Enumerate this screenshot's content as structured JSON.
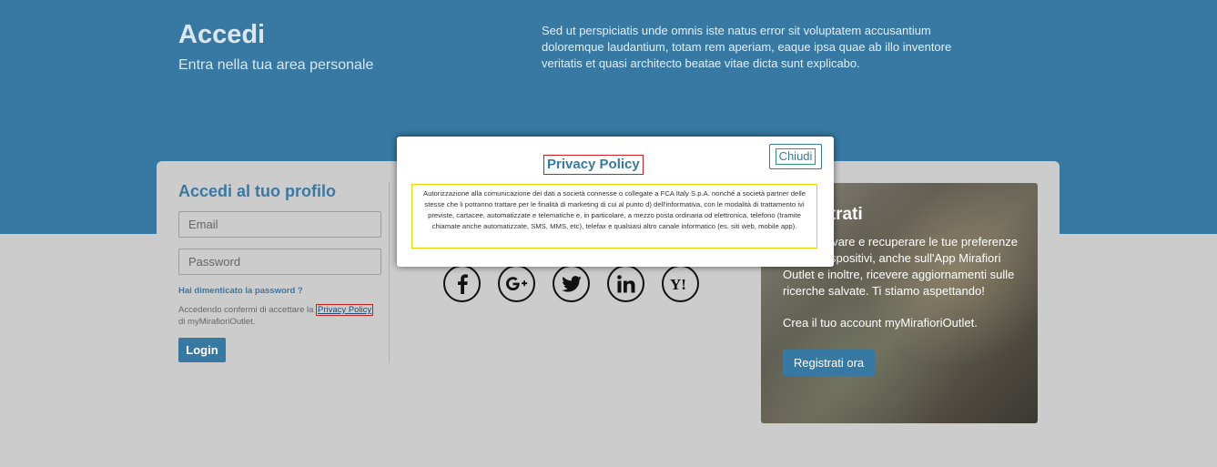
{
  "hero": {
    "title": "Accedi",
    "subtitle": "Entra nella tua area personale",
    "text": "Sed ut perspiciatis unde omnis iste natus error sit voluptatem accusantium doloremque laudantium, totam rem aperiam, eaque ipsa quae ab illo inventore veritatis et quasi architecto beatae vitae dicta sunt explicabo."
  },
  "login": {
    "heading": "Accedi al tuo profilo",
    "email_placeholder": "Email",
    "password_placeholder": "Password",
    "forgot_label": "Hai dimenticato la password ?",
    "consent_prefix": "Accedendo confermi di accettare la",
    "consent_link": "Privacy Policy",
    "consent_suffix": "di myMirafioriOutlet.",
    "login_label": "Login"
  },
  "social": {
    "icons": [
      "facebook-icon",
      "google-plus-icon",
      "twitter-icon",
      "linkedin-icon",
      "yahoo-icon"
    ]
  },
  "promo": {
    "title": "Registrati",
    "text": "Potrai salvare e recuperare le tue preferenze su altri dispositivi, anche sull'App Mirafiori Outlet e inoltre, ricevere aggiornamenti sulle ricerche salvate. Ti stiamo aspettando!",
    "cta_text": "Crea il tuo account myMirafioriOutlet.",
    "register_label": "Registrati ora"
  },
  "modal": {
    "title": "Privacy Policy",
    "close_label": "Chiudi",
    "body": "Autorizzazione alla comunicazione dei dati a società connesse o collegate a FCA Italy S.p.A. nonché a società partner delle stesse che li potranno trattare per le finalità di marketing di cui al punto d) dell'informativa, con le modalità di trattamento ivi previste, cartacee, automatizzate e telematiche e, in particolare, a mezzo posta ordinaria od elettronica, telefono (tramite chiamate anche automatizzate, SMS, MMS, etc), telefax e qualsiasi altro canale informatico (es. siti web, mobile app)."
  },
  "colors": {
    "brand_blue": "#3779a3",
    "page_background": "#cccccc",
    "highlight_red": "#d01e1e",
    "highlight_yellow": "#e6d400"
  }
}
